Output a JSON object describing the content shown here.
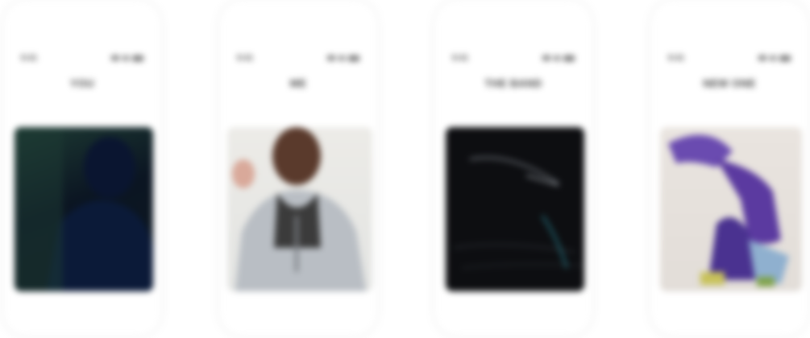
{
  "screens": [
    {
      "status_time": "9:41",
      "title": "YOU",
      "artwork": {
        "description_icon": "album-artwork-dark-portrait",
        "bg": "#0b1522"
      }
    },
    {
      "status_time": "9:41",
      "title": "ME",
      "artwork": {
        "description_icon": "album-artwork-portrait-hoodie",
        "bg": "#e3e4e2"
      }
    },
    {
      "status_time": "9:41",
      "title": "THE BAND",
      "artwork": {
        "description_icon": "album-artwork-dark-abstract",
        "bg": "#0d0e11"
      }
    },
    {
      "status_time": "9:41",
      "title": "NEW ONE",
      "artwork": {
        "description_icon": "album-artwork-dancer-purple",
        "bg": "#e2ddd8"
      }
    }
  ],
  "colors": {
    "phone_bg": "#ffffff",
    "title_text": "#3a3a3a",
    "accent_purple": "#5b3aa0",
    "accent_teal": "#2a8a9a"
  }
}
